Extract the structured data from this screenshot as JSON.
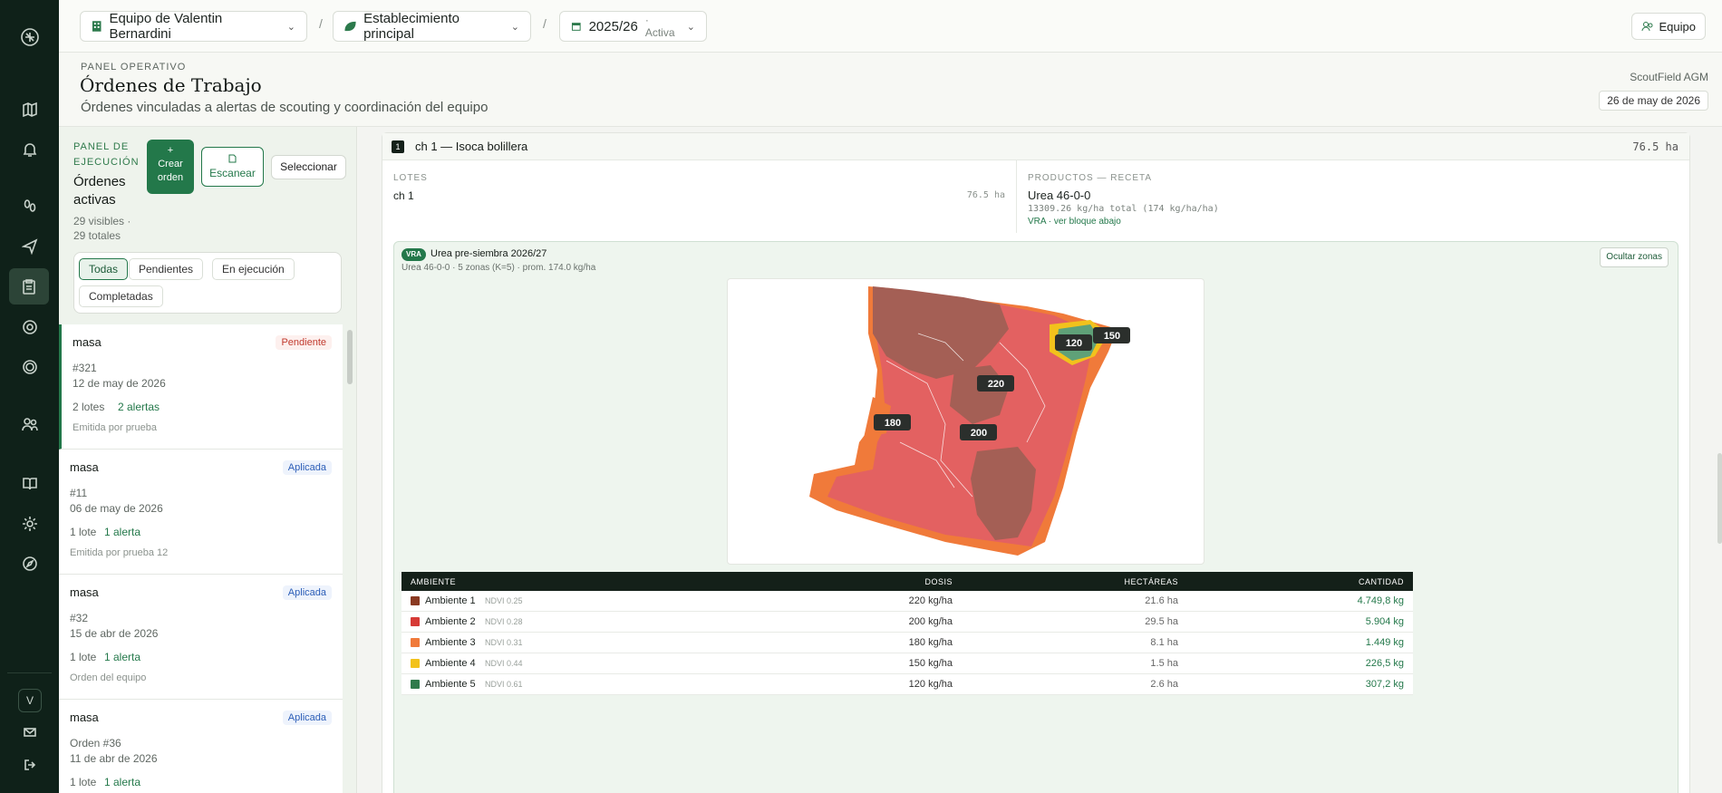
{
  "rail": {
    "items": [
      "map-icon",
      "bell-icon",
      "footprints-icon",
      "send-icon",
      "clipboard-icon",
      "target-icon",
      "scan-icon",
      "users-icon",
      "book-icon",
      "settings-icon",
      "compass-icon"
    ],
    "active_index": 4,
    "avatar": "V"
  },
  "topbar": {
    "team_selector": "Equipo de Valentin Bernardini",
    "establishment_selector": "Establecimiento principal",
    "season_selector": "2025/26",
    "season_status": "· Activa",
    "separator": "/",
    "team_button": "Equipo"
  },
  "header": {
    "eyebrow": "PANEL OPERATIVO",
    "title": "Órdenes de Trabajo",
    "subtitle": "Órdenes vinculadas a alertas de scouting y coordinación del equipo",
    "brand": "ScoutField AGM",
    "date": "26 de may de 2026"
  },
  "panel": {
    "eyebrow": "PANEL DE EJECUCIÓN",
    "title": "Órdenes activas",
    "counts": "29 visibles · 29 totales",
    "create_plus": "+",
    "create_label": "Crear orden",
    "scan_label": "Escanear",
    "select_label": "Seleccionar",
    "filters": [
      "Todas",
      "Pendientes",
      "En ejecución",
      "Completadas"
    ]
  },
  "orders": [
    {
      "name": "masa",
      "status": "Pendiente",
      "code": "#321",
      "date": "12 de may de 2026",
      "lots": "2 lotes",
      "alerts": "2 alertas",
      "issuer": "Emitida por prueba"
    },
    {
      "name": "masa",
      "status": "Aplicada",
      "code": "#11",
      "date": "06 de may de 2026",
      "lots": "1 lote",
      "alerts": "1 alerta",
      "issuer": "Emitida por prueba 12"
    },
    {
      "name": "masa",
      "status": "Aplicada",
      "code": "#32",
      "date": "15 de abr de 2026",
      "lots": "1 lote",
      "alerts": "1 alerta",
      "issuer": "Orden del equipo"
    },
    {
      "name": "masa",
      "status": "Aplicada",
      "code": "Orden #36",
      "date": "11 de abr de 2026",
      "lots": "1 lote",
      "alerts": "1 alerta",
      "issuer": ""
    }
  ],
  "detail": {
    "index": "1",
    "title": "ch 1 — Isoca bolillera",
    "area": "76.5 ha",
    "lotes_label": "LOTES",
    "lot_name": "ch 1",
    "lot_area": "76.5 ha",
    "products_label": "PRODUCTOS — RECETA",
    "product_name": "Urea 46-0-0",
    "product_total": "13309.26 kg/ha total (174 kg/ha/ha)",
    "product_vra": "VRA · ver bloque abajo",
    "vra": {
      "badge": "VRA",
      "title": "Urea pre-siembra 2026/27",
      "subtitle": "Urea 46-0-0 · 5 zonas (K=5) · prom. 174.0 kg/ha",
      "toggle": "Ocultar zonas",
      "zone_labels": [
        "120",
        "150",
        "220",
        "180",
        "200"
      ]
    },
    "table": {
      "headers": {
        "ambiente": "AMBIENTE",
        "dosis": "DOSIS",
        "hectareas": "HECTÁREAS",
        "cantidad": "CANTIDAD"
      },
      "rows": [
        {
          "name": "Ambiente 1",
          "ndvi": "NDVI 0.25",
          "dose": "220 kg/ha",
          "ha": "21.6 ha",
          "qty": "4.749,8 kg",
          "color": "#8a3a22"
        },
        {
          "name": "Ambiente 2",
          "ndvi": "NDVI 0.28",
          "dose": "200 kg/ha",
          "ha": "29.5 ha",
          "qty": "5.904 kg",
          "color": "#d63a36"
        },
        {
          "name": "Ambiente 3",
          "ndvi": "NDVI 0.31",
          "dose": "180 kg/ha",
          "ha": "8.1 ha",
          "qty": "1.449 kg",
          "color": "#f07a3a"
        },
        {
          "name": "Ambiente 4",
          "ndvi": "NDVI 0.44",
          "dose": "150 kg/ha",
          "ha": "1.5 ha",
          "qty": "226,5 kg",
          "color": "#f2c21c"
        },
        {
          "name": "Ambiente 5",
          "ndvi": "NDVI 0.61",
          "dose": "120 kg/ha",
          "ha": "2.6 ha",
          "qty": "307,2 kg",
          "color": "#2f7a4b"
        }
      ]
    }
  }
}
